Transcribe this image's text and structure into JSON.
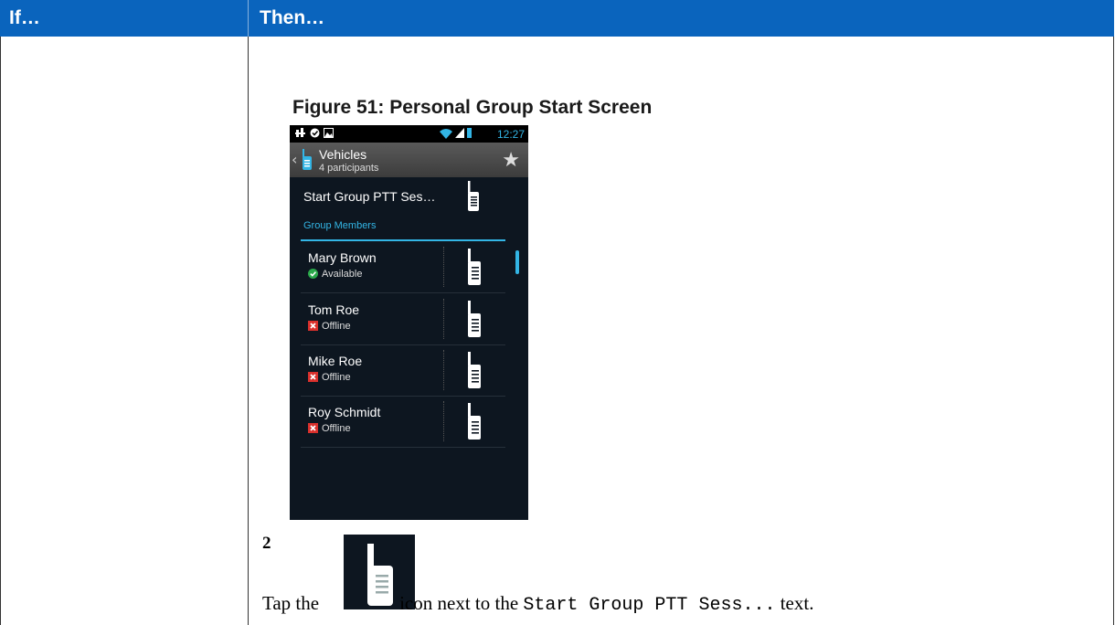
{
  "table": {
    "header": {
      "if_label": "If…",
      "then_label": "Then…"
    }
  },
  "figure": {
    "title": "Figure 51: Personal Group Start Screen"
  },
  "phone": {
    "status_time": "12:27",
    "group_name": "Vehicles",
    "participants": "4 participants",
    "start_label": "Start Group PTT Ses…",
    "section_label": "Group Members",
    "members": [
      {
        "name": "Mary Brown",
        "status": "Available",
        "status_color": "#2aa84a"
      },
      {
        "name": "Tom Roe",
        "status": "Offline",
        "status_color": "#d9302c"
      },
      {
        "name": "Mike Roe",
        "status": "Offline",
        "status_color": "#d9302c"
      },
      {
        "name": "Roy Schmidt",
        "status": "Offline",
        "status_color": "#d9302c"
      }
    ]
  },
  "step": {
    "number": "2",
    "text_before": "Tap the",
    "text_middle": "icon next to the",
    "code": "Start Group PTT Sess...",
    "text_after": "text."
  },
  "colors": {
    "header_bg": "#0a64bd",
    "accent": "#33b5e5",
    "screen_bg": "#0d1620"
  }
}
